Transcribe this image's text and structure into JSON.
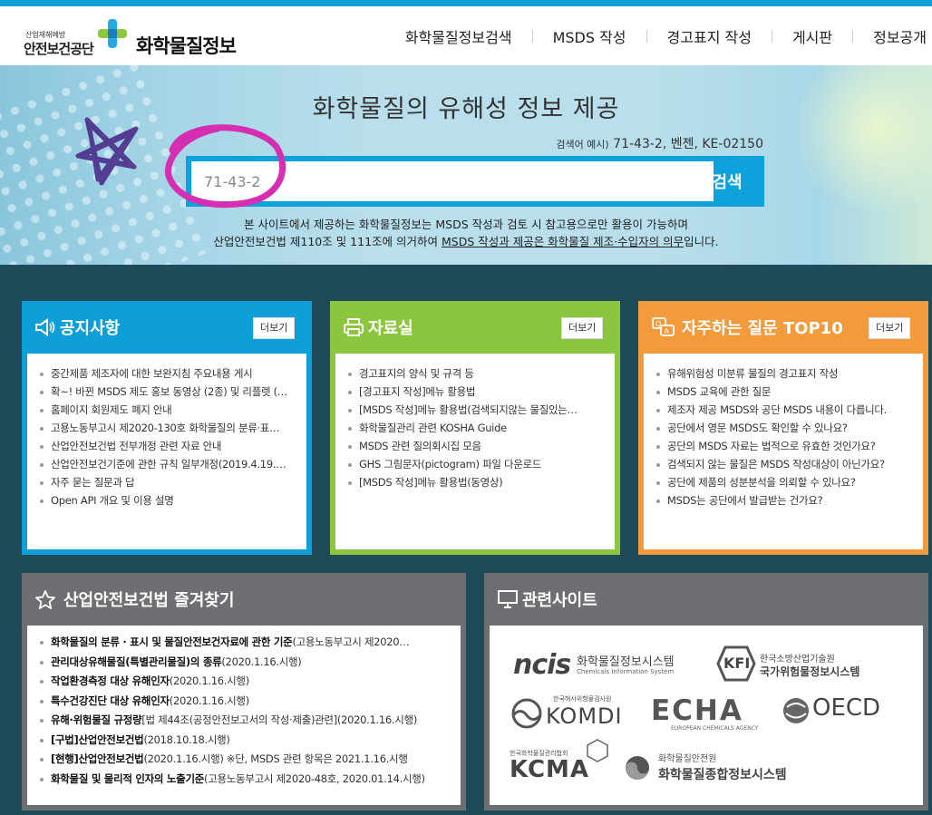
{
  "header": {
    "logo_small": "산업재해예방",
    "logo_org": "안전보건공단",
    "logo_title": "화학물질정보",
    "nav": [
      "화학물질정보검색",
      "MSDS 작성",
      "경고표지 작성",
      "게시판",
      "정보공개"
    ]
  },
  "hero": {
    "title": "화학물질의 유해성 정보 제공",
    "example_label": "검색어 예시)",
    "example_values": "71-43-2, 벤젠, KE-02150",
    "search_value": "71-43-2",
    "search_button": "검색",
    "notice_line1": "본 사이트에서 제공하는 화학물질정보는 MSDS 작성과 검토 시 참고용으로만 활용이 가능하며",
    "notice_line2_pre": "산업안전보건법 제110조 및 111조에 의거하여 ",
    "notice_line2_link": "MSDS 작성과 제공은 화학물질 제조·수입자의 의무",
    "notice_line2_post": "입니다."
  },
  "cards": {
    "notice": {
      "title": "공지사항",
      "more": "더보기",
      "items": [
        "중간제품 제조자에 대한 보완지침 주요내용 게시",
        "확~! 바뀐 MSDS 제도 홍보 동영상 (2종) 및 리플렛 (…",
        "홈페이지 회원제도 폐지 안내",
        "고용노동부고시 제2020-130호 화학물질의 분류·표…",
        "산업안전보건법 전부개정 관련 자료 안내",
        "산업안전보건기준에 관한 규칙 일부개정(2019.4.19.…",
        "자주 묻는 질문과 답",
        "Open API 개요 및 이용 설명"
      ]
    },
    "library": {
      "title": "자료실",
      "more": "더보기",
      "items": [
        "경고표지의 양식 및 규격 등",
        "[경고표지 작성]메뉴 활용법",
        "[MSDS 작성]메뉴 활용법(검색되지않는 물질있는…",
        "화학물질관리 관련 KOSHA Guide",
        "MSDS 관련 질의회시집 모음",
        "GHS 그림문자(pictogram) 파일 다운로드",
        "[MSDS 작성]메뉴 활용법(동영상)"
      ]
    },
    "faq": {
      "title": "자주하는 질문 TOP10",
      "more": "더보기",
      "items": [
        "유해위험성 미분류 물질의 경고표지 작성",
        "MSDS 교육에 관한 질문",
        "제조자 제공 MSDS와 공단 MSDS 내용이 다릅니다.",
        "공단에서 영문 MSDS도 확인할 수 있나요?",
        "공단의 MSDS 자료는 법적으로 유효한 것인가요?",
        "검색되지 않는 물질은 MSDS 작성대상이 아닌가요?",
        "공단에 제품의 성분분석을 의뢰할 수 있나요?",
        "MSDS는 공단에서 발급받는 건가요?"
      ]
    },
    "law": {
      "title": "산업안전보건법 즐겨찾기",
      "items": [
        {
          "bold": "화학물질의 분류 · 표시 및 물질안전보건자료에 관한 기준",
          "rest": "(고용노동부고시 제2020…"
        },
        {
          "bold": "관리대상유해물질(특별관리물질)의 종류",
          "rest": "(2020.1.16.시행)"
        },
        {
          "bold": "작업환경측정 대상 유해인자",
          "rest": "(2020.1.16.시행)"
        },
        {
          "bold": "특수건강진단 대상 유해인자",
          "rest": "(2020.1.16.시행)"
        },
        {
          "bold": "유해·위험물질 규정량",
          "rest": "[법 제44조(공정안전보고서의 작성·제출)관련](2020.1.16.시행)"
        },
        {
          "bold": "[구법]산업안전보건법",
          "rest": "(2018.10.18.시행)"
        },
        {
          "bold": "[현행]산업안전보건법",
          "rest": "(2020.1.16.시행) ※단, MSDS 관련 항목은 2021.1.16.시행"
        },
        {
          "bold": "화학물질 및 물리적 인자의 노출기준",
          "rest": "(고용노동부고시 제2020-48호, 2020.01.14.시행)"
        }
      ]
    },
    "sites": {
      "title": "관련사이트",
      "ncis_logo": "ncis",
      "ncis_name": "화학물질정보시스템",
      "ncis_sub": "Chemicals Information System",
      "kfi_logo": "KFI",
      "kfi_name1": "한국소방산업기술원",
      "kfi_name2": "국가위험물정보시스템",
      "komdi_top": "한국해사위험물검사원",
      "komdi_logo": "KOMDI",
      "echa_logo": "ECHA",
      "echa_sub": "EUROPEAN CHEMICALS AGENCY",
      "oecd_logo": "OECD",
      "kcma_top": "한국화학물질관리협회",
      "kcma_logo": "KCMA",
      "ichn_top": "화학물질안전원",
      "ichn_name": "화학물질종합정보시스템"
    }
  },
  "colors": {
    "blue": "#0f9fd8",
    "green": "#8cc63e",
    "orange": "#f39a3d",
    "gray": "#6d6f72",
    "dark_bg": "#1f4a5a"
  }
}
